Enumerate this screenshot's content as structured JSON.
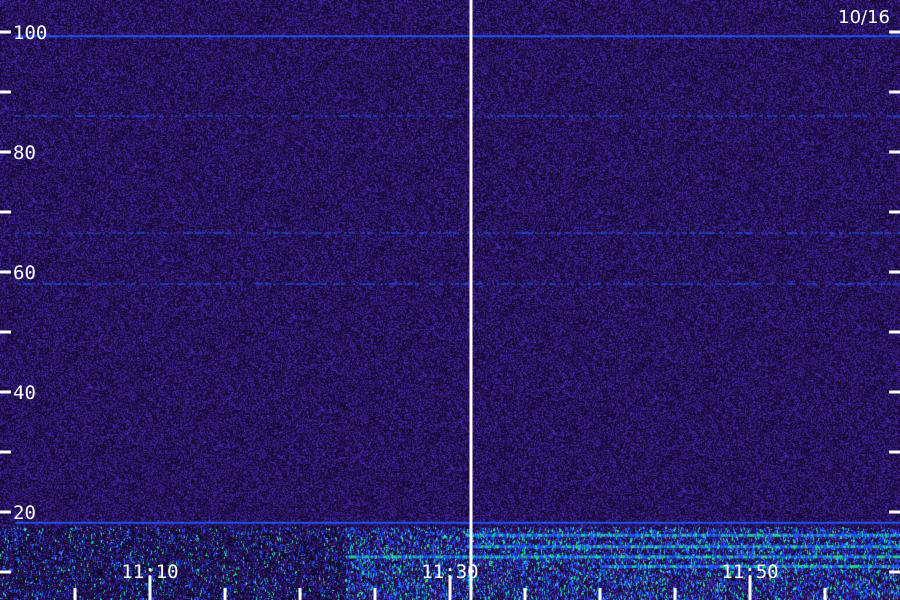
{
  "chart_data": {
    "type": "heatmap",
    "date_label": "10/16",
    "y_ticks_major": [
      20,
      40,
      60,
      80,
      100
    ],
    "y_ticks_minor": [
      10,
      30,
      50,
      70,
      90
    ],
    "ylim": [
      10,
      100
    ],
    "x_tick_labels": [
      "11:10",
      "11:30",
      "11:50"
    ],
    "x_range": [
      "11:01",
      "11:59"
    ],
    "marker_time": "11:31",
    "colors": {
      "background": "#2a1070",
      "noise_dark": "#150830",
      "noise_light": "#4a2cc0",
      "band": "#1f5cff",
      "hot": "#27e0a0",
      "axis": "#ffffff"
    },
    "bands": [
      {
        "freq": 99.3,
        "start": "11:01",
        "end": "11:59",
        "strength": "medium"
      },
      {
        "freq": 86,
        "start": "11:01",
        "end": "11:59",
        "strength": "weak"
      },
      {
        "freq": 66.5,
        "start": "11:01",
        "end": "11:59",
        "strength": "weak"
      },
      {
        "freq": 58,
        "start": "11:01",
        "end": "11:59",
        "strength": "weak"
      },
      {
        "freq": 18.2,
        "start": "11:01",
        "end": "11:59",
        "strength": "medium"
      },
      {
        "freq": 16.2,
        "start": "11:31",
        "end": "11:59",
        "strength": "strong"
      },
      {
        "freq": 14.3,
        "start": "11:31",
        "end": "11:59",
        "strength": "strong"
      },
      {
        "freq": 12.6,
        "start": "11:23",
        "end": "11:59",
        "strength": "strong"
      },
      {
        "freq": 11,
        "start": "11:40",
        "end": "11:59",
        "strength": "strong"
      }
    ]
  }
}
